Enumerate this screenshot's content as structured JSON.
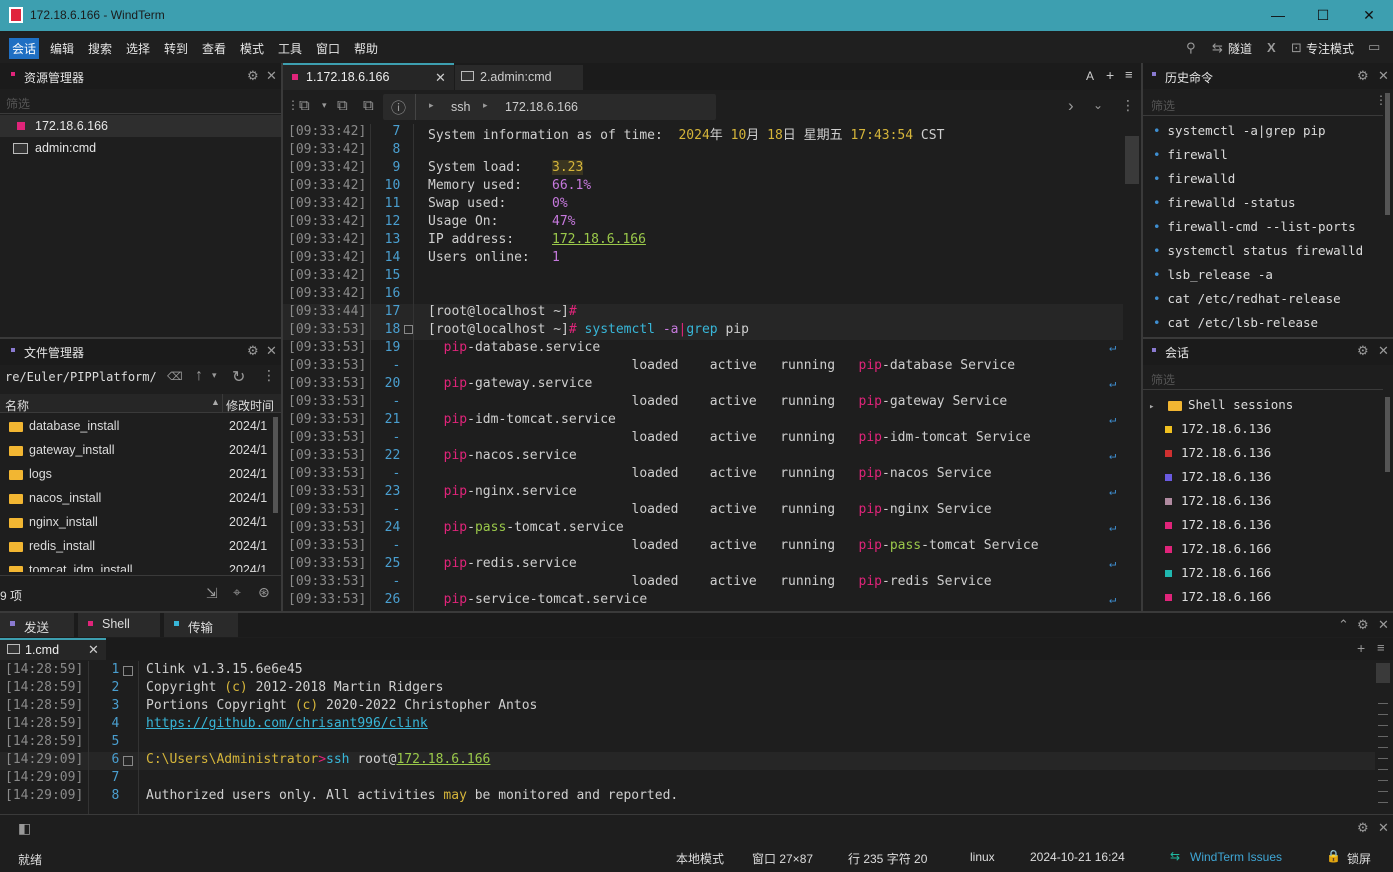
{
  "window": {
    "title": "172.18.6.166 - WindTerm",
    "minimize": "—",
    "maximize": "☐",
    "close": "✕"
  },
  "menu": {
    "items": [
      "会话",
      "编辑",
      "搜索",
      "选择",
      "转到",
      "查看",
      "模式",
      "工具",
      "窗口",
      "帮助"
    ],
    "right": {
      "tunnel": "隧道",
      "focus": "专注模式"
    }
  },
  "resource_manager": {
    "title": "资源管理器",
    "filter_placeholder": "筛选",
    "items": [
      {
        "label": "172.18.6.166",
        "color": "#e0247a"
      },
      {
        "label": "admin:cmd",
        "icon": "terminal-icon"
      }
    ]
  },
  "file_manager": {
    "title": "文件管理器",
    "path": "re/Euler/PIPPlatform/",
    "col_name": "名称",
    "col_mtime": "修改时间",
    "rows": [
      {
        "name": "database_install",
        "mtime": "2024/1"
      },
      {
        "name": "gateway_install",
        "mtime": "2024/1"
      },
      {
        "name": "logs",
        "mtime": "2024/1"
      },
      {
        "name": "nacos_install",
        "mtime": "2024/1"
      },
      {
        "name": "nginx_install",
        "mtime": "2024/1"
      },
      {
        "name": "redis_install",
        "mtime": "2024/1"
      },
      {
        "name": "tomcat_idm_install",
        "mtime": "2024/1"
      }
    ],
    "count": "9 项"
  },
  "tabs": [
    {
      "label": "1.172.18.6.166",
      "active": true
    },
    {
      "label": "2.admin:cmd",
      "active": false
    }
  ],
  "tabbar_right": {
    "font": "A",
    "add": "+",
    "menu": "≡"
  },
  "address": {
    "proto": "ssh",
    "host": "172.18.6.166"
  },
  "terminal": {
    "lines": [
      {
        "ts": "[09:33:42]",
        "ln": "7"
      },
      {
        "ts": "[09:33:42]",
        "ln": "8"
      },
      {
        "ts": "[09:33:42]",
        "ln": "9"
      },
      {
        "ts": "[09:33:42]",
        "ln": "10"
      },
      {
        "ts": "[09:33:42]",
        "ln": "11"
      },
      {
        "ts": "[09:33:42]",
        "ln": "12"
      },
      {
        "ts": "[09:33:42]",
        "ln": "13"
      },
      {
        "ts": "[09:33:42]",
        "ln": "14"
      },
      {
        "ts": "[09:33:42]",
        "ln": "15"
      },
      {
        "ts": "[09:33:42]",
        "ln": "16"
      },
      {
        "ts": "[09:33:44]",
        "ln": "17"
      },
      {
        "ts": "[09:33:53]",
        "ln": "18"
      },
      {
        "ts": "[09:33:53]",
        "ln": "19"
      },
      {
        "ts": "[09:33:53]",
        "ln": "-"
      },
      {
        "ts": "[09:33:53]",
        "ln": "20"
      },
      {
        "ts": "[09:33:53]",
        "ln": "-"
      },
      {
        "ts": "[09:33:53]",
        "ln": "21"
      },
      {
        "ts": "[09:33:53]",
        "ln": "-"
      },
      {
        "ts": "[09:33:53]",
        "ln": "22"
      },
      {
        "ts": "[09:33:53]",
        "ln": "-"
      },
      {
        "ts": "[09:33:53]",
        "ln": "23"
      },
      {
        "ts": "[09:33:53]",
        "ln": "-"
      },
      {
        "ts": "[09:33:53]",
        "ln": "24"
      },
      {
        "ts": "[09:33:53]",
        "ln": "-"
      },
      {
        "ts": "[09:33:53]",
        "ln": "25"
      },
      {
        "ts": "[09:33:53]",
        "ln": "-"
      },
      {
        "ts": "[09:33:53]",
        "ln": "26"
      }
    ],
    "sysinfo": {
      "header": "System information as of time:",
      "date_y": "2024",
      "u_y": "年",
      "date_m": "10",
      "u_m": "月",
      "date_d": "18",
      "u_d": "日",
      "weekday": "星期五",
      "time": "17:43:54",
      "tz": "CST",
      "load_label": "System load:",
      "load": "3.23",
      "mem_label": "Memory used:",
      "mem": "66.1%",
      "swap_label": "Swap used:",
      "swap": "0%",
      "usage_label": "Usage On:",
      "usage": "47%",
      "ip_label": "IP address:",
      "ip": "172.18.6.166",
      "users_label": "Users online:",
      "users": "1"
    },
    "prompt": "[root@localhost ~]",
    "hash": "#",
    "cmd1": "systemctl",
    "cmd2": "-a",
    "cmd3": "|",
    "cmd4": "grep",
    "cmd5": "pip",
    "status": {
      "loaded": "loaded",
      "active": "active",
      "running": "running"
    },
    "services": [
      {
        "a": "pip",
        "b": "-database.service",
        "desc_b": "-database Service"
      },
      {
        "a": "pip",
        "b": "-gateway.service",
        "desc_b": "-gateway Service"
      },
      {
        "a": "pip",
        "b": "-idm-tomcat.service",
        "desc_b": "-idm-tomcat Service"
      },
      {
        "a": "pip",
        "b": "-nacos.service",
        "desc_b": "-nacos Service"
      },
      {
        "a": "pip",
        "b": "-nginx.service",
        "desc_b": "-nginx Service"
      },
      {
        "a": "pip",
        "b": "-",
        "c": "pass",
        "d": "-tomcat.service",
        "desc_b": "-",
        "desc_c": "pass",
        "desc_d": "-tomcat Service"
      },
      {
        "a": "pip",
        "b": "-redis.service",
        "desc_b": "-redis Service"
      },
      {
        "a": "pip",
        "b": "-service-tomcat.service"
      }
    ]
  },
  "history": {
    "title": "历史命令",
    "filter_placeholder": "筛选",
    "items": [
      "systemctl -a|grep pip",
      "firewall",
      "firewalld",
      "firewalld -status",
      "firewall-cmd --list-ports",
      "systemctl status firewalld",
      "lsb_release -a",
      "cat /etc/redhat-release",
      "cat /etc/lsb-release"
    ]
  },
  "sessions": {
    "title": "会话",
    "filter_placeholder": "筛选",
    "group": "Shell sessions",
    "items": [
      {
        "label": "172.18.6.136",
        "color": "#f0c020"
      },
      {
        "label": "172.18.6.136",
        "color": "#d03030"
      },
      {
        "label": "172.18.6.136",
        "color": "#6a5ae0"
      },
      {
        "label": "172.18.6.136",
        "color": "#b08aa0"
      },
      {
        "label": "172.18.6.136",
        "color": "#e0247a"
      },
      {
        "label": "172.18.6.166",
        "color": "#e0247a"
      },
      {
        "label": "172.18.6.166",
        "color": "#20b8b0"
      },
      {
        "label": "172.18.6.166",
        "color": "#e0247a"
      }
    ]
  },
  "bottom_tabs": [
    {
      "label": "发送",
      "color": "#8a7ad0"
    },
    {
      "label": "Shell",
      "color": "#e0247a"
    },
    {
      "label": "传输",
      "color": "#38b6d8"
    }
  ],
  "cmd_tab": {
    "label": "1.cmd"
  },
  "cmd_terminal": {
    "lines": [
      {
        "ts": "[14:28:59]",
        "ln": "1"
      },
      {
        "ts": "[14:28:59]",
        "ln": "2"
      },
      {
        "ts": "[14:28:59]",
        "ln": "3"
      },
      {
        "ts": "[14:28:59]",
        "ln": "4"
      },
      {
        "ts": "[14:28:59]",
        "ln": "5"
      },
      {
        "ts": "[14:29:09]",
        "ln": "6"
      },
      {
        "ts": "[14:29:09]",
        "ln": "7"
      },
      {
        "ts": "[14:29:09]",
        "ln": "8"
      }
    ],
    "l1": "Clink v1.3.15.6e6e45",
    "l2a": "Copyright ",
    "l2b": "(c)",
    "l2c": " 2012-2018 Martin Ridgers",
    "l3a": "Portions Copyright ",
    "l3b": "(c)",
    "l3c": " 2020-2022 Christopher Antos",
    "l4": "https://github.com/chrisant996/clink",
    "l6a": "C:\\Users\\Administrator",
    "l6b": ">",
    "l6c": "ssh",
    "l6d": " root@",
    "l6e": "172.18.6.166",
    "l8a": "Authorized users only. All activities ",
    "l8b": "may",
    "l8c": " be monitored and reported."
  },
  "statusbar": {
    "ready": "就绪",
    "mode": "本地模式",
    "window": "窗口 27×87",
    "cursor": "行 235 字符 20",
    "os": "linux",
    "datetime": "2024-10-21 16:24",
    "issues": "WindTerm Issues",
    "lock": "锁屏"
  }
}
